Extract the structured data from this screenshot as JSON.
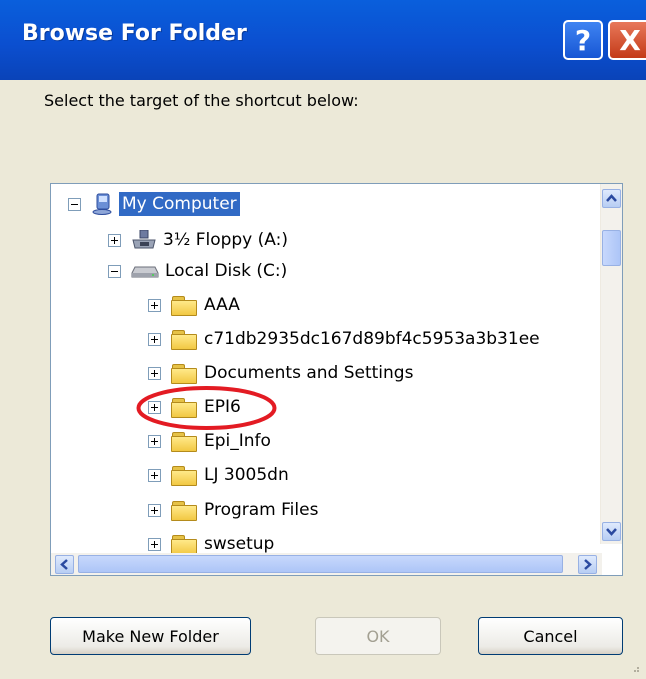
{
  "window": {
    "title": "Browse For Folder",
    "help_glyph": "?",
    "close_glyph": "X"
  },
  "prompt": "Select the target of the shortcut below:",
  "tree": {
    "items": [
      {
        "label": "My Computer",
        "icon": "computer-icon",
        "expander": "minus",
        "selected": true
      },
      {
        "label": "3½ Floppy (A:)",
        "icon": "floppy-icon",
        "expander": "plus"
      },
      {
        "label": "Local Disk (C:)",
        "icon": "disk-icon",
        "expander": "minus"
      },
      {
        "label": "AAA",
        "icon": "folder-icon",
        "expander": "plus"
      },
      {
        "label": "c71db2935dc167d89bf4c5953a3b31ee",
        "icon": "folder-icon",
        "expander": "plus"
      },
      {
        "label": "Documents and Settings",
        "icon": "folder-icon",
        "expander": "plus"
      },
      {
        "label": "EPI6",
        "icon": "folder-icon",
        "expander": "plus",
        "highlighted": true
      },
      {
        "label": "Epi_Info",
        "icon": "folder-icon",
        "expander": "plus"
      },
      {
        "label": "LJ 3005dn",
        "icon": "folder-icon",
        "expander": "plus"
      },
      {
        "label": "Program Files",
        "icon": "folder-icon",
        "expander": "plus"
      },
      {
        "label": "swsetup",
        "icon": "folder-icon",
        "expander": "plus"
      }
    ]
  },
  "buttons": {
    "make_new_folder": "Make New Folder",
    "ok": "OK",
    "cancel": "Cancel"
  },
  "colors": {
    "title_bar": "#0b4fd0",
    "selection": "#316ac5",
    "annotation": "#e31b23",
    "dialog_bg": "#ece9d8"
  }
}
